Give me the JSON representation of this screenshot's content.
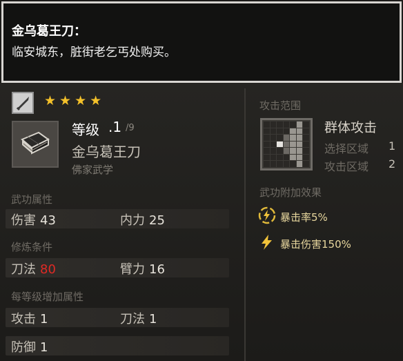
{
  "tooltip": {
    "title": "金乌葛王刀：",
    "description": "临安城东，脏街老乞丐处购买。"
  },
  "item": {
    "rarity_stars": 4,
    "level_label": "等级",
    "level_value": ".1",
    "level_max": "/9",
    "name": "金乌葛王刀",
    "school": "佛家武学"
  },
  "sections": {
    "martial_attributes": "武功属性",
    "requirements": "修炼条件",
    "per_level_bonus": "每等级增加属性",
    "attack_range": "攻击范围",
    "extra_effects": "武功附加效果"
  },
  "martial_attributes": [
    {
      "label": "伤害",
      "value": "43"
    },
    {
      "label": "内力",
      "value": "25"
    }
  ],
  "requirements": [
    {
      "label": "刀法",
      "value": "80",
      "unmet": true
    },
    {
      "label": "臂力",
      "value": "16",
      "unmet": false
    }
  ],
  "per_level_bonus": [
    {
      "label": "攻击",
      "value": "1"
    },
    {
      "label": "刀法",
      "value": "1"
    },
    {
      "label": "防御",
      "value": "1"
    }
  ],
  "range": {
    "type": "群体攻击",
    "select_label": "选择区域",
    "select_value": "1",
    "attack_label": "攻击区域",
    "attack_value": "2"
  },
  "effects": [
    {
      "label": "暴击率5%",
      "icon": "lightning-circle-icon"
    },
    {
      "label": "暴击伤害150%",
      "icon": "lightning-icon"
    }
  ],
  "colors": {
    "star": "#f4c12a",
    "unmet_requirement": "#e02a25",
    "effect_text": "#e8d79e"
  }
}
